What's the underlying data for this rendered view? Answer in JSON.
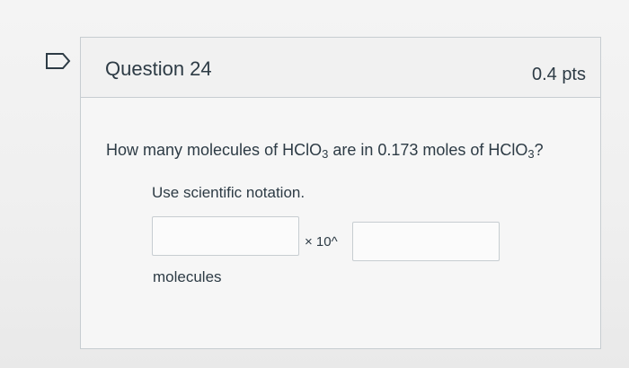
{
  "question": {
    "title": "Question 24",
    "points": "0.4 pts",
    "text_prefix": "How many molecules of HClO",
    "sub_1": "3",
    "text_middle": " are in 0.173 moles of HClO",
    "sub_2": "3",
    "text_suffix": "?",
    "instructions": "Use scientific notation.",
    "times_label": "× 10^",
    "unit_label": "molecules"
  },
  "inputs": {
    "mantissa_value": "",
    "exponent_value": ""
  },
  "icons": {
    "flag": "flag-question-icon"
  }
}
